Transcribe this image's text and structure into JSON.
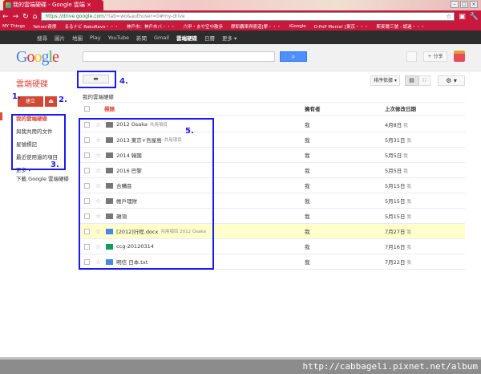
{
  "browser": {
    "tab_title": "我的雲端硬碟 - Google 雲端",
    "url_host": "https://drive.google.com",
    "url_rest": "/?tab=wo&authuser=0#my-drive",
    "bookmarks": [
      "MY Things",
      "Yahoo!奇摩",
      "るるナビ RakuRavo・・・",
      "神戶市：神戶市バ・・・",
      "六甲・まや空中散歩",
      "摩耶纜車與索道[摩・・・",
      "iGoogle",
      "D-PoP Mania! [東京・・・",
      "斯麥爾三號 - 認過・・・"
    ]
  },
  "gnav": [
    "搜尋",
    "圖片",
    "地圖",
    "Play",
    "YouTube",
    "新聞",
    "Gmail",
    "雲端硬碟",
    "日曆",
    "更多 ▾"
  ],
  "header": {
    "logo": "Google",
    "search_placeholder": "",
    "share": "+ 分享"
  },
  "sidebar": {
    "brand": "雲端硬碟",
    "create": "建立",
    "items": [
      "我的雲端硬碟",
      "與我共用的文件",
      "星號標記",
      "最近使用過的項目",
      "更多 ▾"
    ],
    "download": "下載 Google 雲端硬碟"
  },
  "toolbar": {
    "sort": "排序依據 ▾"
  },
  "list": {
    "breadcrumb": "我的雲端硬碟",
    "col_title": "標題",
    "col_owner": "擁有者",
    "col_date": "上次修改日期",
    "rows": [
      {
        "name": "2012 Osaka",
        "shared": "共用項目",
        "type": "shared-folder",
        "owner": "我",
        "date": "4月8日",
        "by": "我"
      },
      {
        "name": "2013 東京+吾屋島",
        "shared": "共用項目",
        "type": "shared-folder",
        "owner": "我",
        "date": "5月31日",
        "by": "我"
      },
      {
        "name": "2014 韓國",
        "shared": "",
        "type": "folder",
        "owner": "我",
        "date": "5月5日",
        "by": "我"
      },
      {
        "name": "2016 巴黎",
        "shared": "",
        "type": "folder",
        "owner": "我",
        "date": "5月5日",
        "by": "我"
      },
      {
        "name": "合購區",
        "shared": "",
        "type": "folder",
        "owner": "我",
        "date": "5月15日",
        "by": "我"
      },
      {
        "name": "帳戶理財",
        "shared": "",
        "type": "folder",
        "owner": "我",
        "date": "5月15日",
        "by": "我"
      },
      {
        "name": "雜項",
        "shared": "",
        "type": "folder",
        "owner": "我",
        "date": "5月15日",
        "by": "我"
      },
      {
        "name": "[2012]行程.docx",
        "shared": "共用項目  2012 Osaka",
        "type": "doc",
        "owner": "我",
        "date": "7月27日",
        "by": "我"
      },
      {
        "name": "ccg-20120314",
        "shared": "",
        "type": "sheet",
        "owner": "我",
        "date": "7月16日",
        "by": "我"
      },
      {
        "name": "明信 日本.txt",
        "shared": "",
        "type": "txt",
        "owner": "我",
        "date": "7月22日",
        "by": "我"
      }
    ]
  },
  "annotations": [
    "1.",
    "2.",
    "3.",
    "4.",
    "5."
  ],
  "watermark": "http://cabbageli.pixnet.net/album"
}
